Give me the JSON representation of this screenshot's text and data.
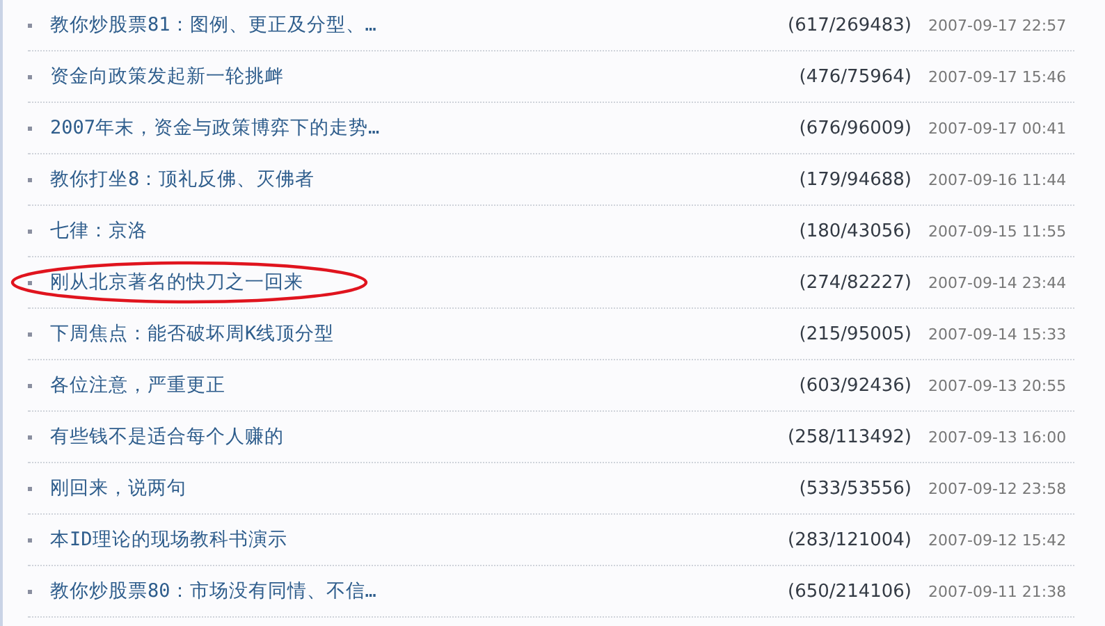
{
  "posts": [
    {
      "title": "教你炒股票81：图例、更正及分型、…",
      "count": "(617/269483)",
      "date": "2007-09-17 22:57",
      "circled": false
    },
    {
      "title": "资金向政策发起新一轮挑衅",
      "count": "(476/75964)",
      "date": "2007-09-17 15:46",
      "circled": false
    },
    {
      "title": "2007年末，资金与政策博弈下的走势…",
      "count": "(676/96009)",
      "date": "2007-09-17 00:41",
      "circled": false
    },
    {
      "title": "教你打坐8：顶礼反佛、灭佛者",
      "count": "(179/94688)",
      "date": "2007-09-16 11:44",
      "circled": false
    },
    {
      "title": "七律：京洛",
      "count": "(180/43056)",
      "date": "2007-09-15 11:55",
      "circled": false
    },
    {
      "title": "刚从北京著名的快刀之一回来",
      "count": "(274/82227)",
      "date": "2007-09-14 23:44",
      "circled": true
    },
    {
      "title": "下周焦点：能否破坏周K线顶分型",
      "count": "(215/95005)",
      "date": "2007-09-14 15:33",
      "circled": false
    },
    {
      "title": "各位注意，严重更正",
      "count": "(603/92436)",
      "date": "2007-09-13 20:55",
      "circled": false
    },
    {
      "title": "有些钱不是适合每个人赚的",
      "count": "(258/113492)",
      "date": "2007-09-13 16:00",
      "circled": false
    },
    {
      "title": "刚回来，说两句",
      "count": "(533/53556)",
      "date": "2007-09-12 23:58",
      "circled": false
    },
    {
      "title": "本ID理论的现场教科书演示",
      "count": "(283/121004)",
      "date": "2007-09-12 15:42",
      "circled": false
    },
    {
      "title": "教你炒股票80：市场没有同情、不信…",
      "count": "(650/214106)",
      "date": "2007-09-11 21:38",
      "circled": false
    }
  ]
}
